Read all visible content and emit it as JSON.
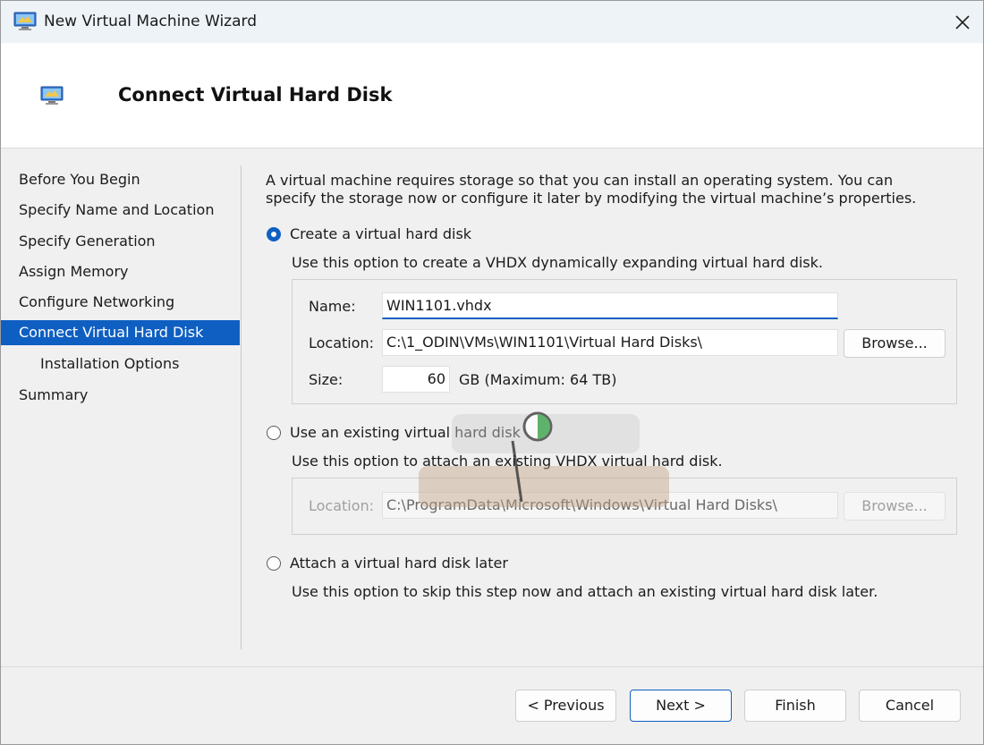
{
  "window": {
    "title": "New Virtual Machine Wizard"
  },
  "header": {
    "title": "Connect Virtual Hard Disk"
  },
  "sidebar": {
    "items": [
      {
        "label": "Before You Begin"
      },
      {
        "label": "Specify Name and Location"
      },
      {
        "label": "Specify Generation"
      },
      {
        "label": "Assign Memory"
      },
      {
        "label": "Configure Networking"
      },
      {
        "label": "Connect Virtual Hard Disk"
      },
      {
        "label": "Installation Options"
      },
      {
        "label": "Summary"
      }
    ],
    "active_index": 5
  },
  "content": {
    "intro": "A virtual machine requires storage so that you can install an operating system. You can specify the storage now or configure it later by modifying the virtual machine’s properties.",
    "create": {
      "label": "Create a virtual hard disk",
      "desc": "Use this option to create a VHDX dynamically expanding virtual hard disk.",
      "name_label": "Name:",
      "name_value": "WIN1101.vhdx",
      "location_label": "Location:",
      "location_value": "C:\\1_ODIN\\VMs\\WIN1101\\Virtual Hard Disks\\",
      "browse_label": "Browse...",
      "size_label": "Size:",
      "size_value": "60",
      "size_unit": "GB (Maximum: 64 TB)",
      "selected": true
    },
    "existing": {
      "label": "Use an existing virtual hard disk",
      "desc": "Use this option to attach an existing VHDX virtual hard disk.",
      "location_label": "Location:",
      "location_value": "C:\\ProgramData\\Microsoft\\Windows\\Virtual Hard Disks\\",
      "browse_label": "Browse..."
    },
    "later": {
      "label": "Attach a virtual hard disk later",
      "desc": "Use this option to skip this step now and attach an existing virtual hard disk later."
    }
  },
  "footer": {
    "previous": "< Previous",
    "next": "Next >",
    "finish": "Finish",
    "cancel": "Cancel"
  },
  "colors": {
    "accent": "#0f5fc2",
    "titlebar": "#eef3f8"
  }
}
